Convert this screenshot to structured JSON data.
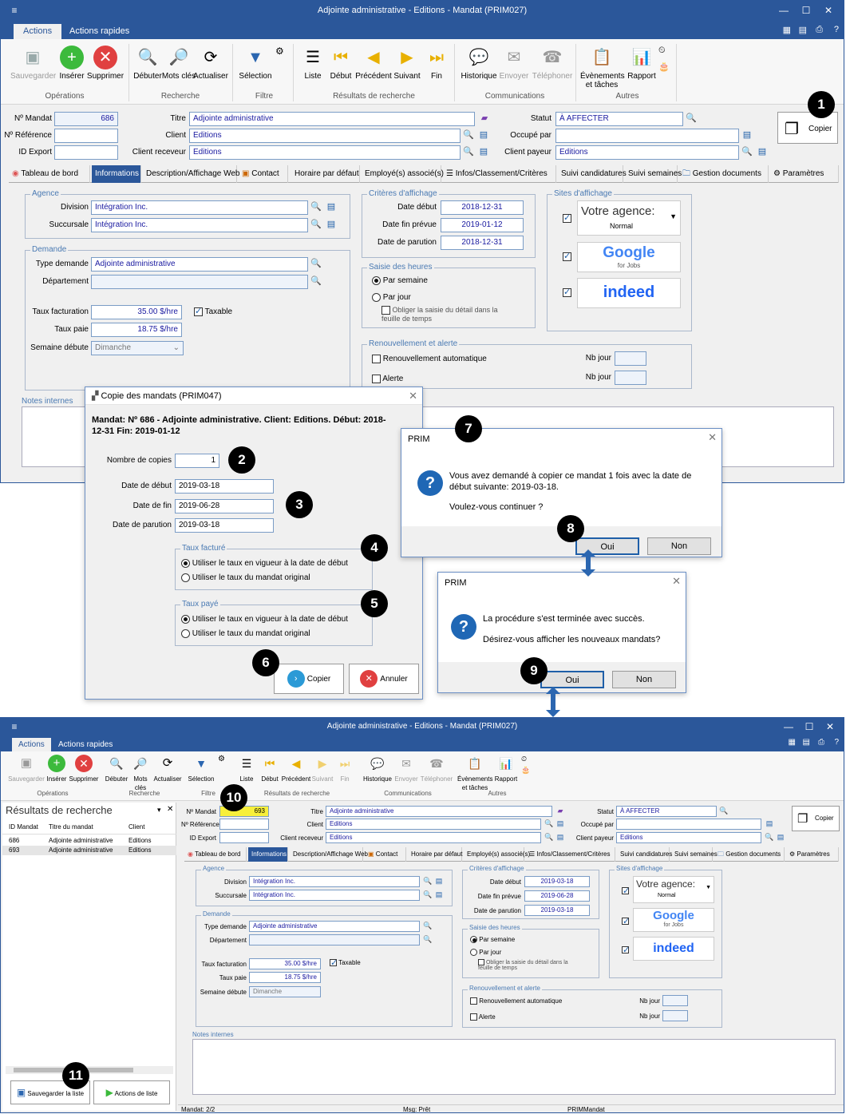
{
  "app_title": "Adjointe administrative - Editions - Mandat (PRIM027)",
  "tabs": [
    "Actions",
    "Actions rapides"
  ],
  "ribbon": {
    "operations": {
      "label": "Opérations",
      "buttons": [
        "Sauvegarder",
        "Insérer",
        "Supprimer"
      ]
    },
    "recherche": {
      "label": "Recherche",
      "buttons": [
        "Débuter",
        "Mots clés",
        "Actualiser"
      ]
    },
    "filtre": {
      "label": "Filtre",
      "buttons": [
        "Sélection"
      ]
    },
    "resultats": {
      "label": "Résultats de recherche",
      "buttons": [
        "Liste",
        "Début",
        "Précédent",
        "Suivant",
        "Fin"
      ]
    },
    "communications": {
      "label": "Communications",
      "buttons": [
        "Historique",
        "Envoyer",
        "Téléphoner"
      ]
    },
    "autres": {
      "label": "Autres",
      "buttons": [
        "Évènements et tâches",
        "Rapport"
      ]
    }
  },
  "header_labels": {
    "no_mandat": "Nº Mandat",
    "no_reference": "Nº Référence",
    "id_export": "ID Export",
    "titre": "Titre",
    "client": "Client",
    "client_receveur": "Client receveur",
    "statut": "Statut",
    "occupe_par": "Occupé par",
    "client_payeur": "Client payeur",
    "copier": "Copier"
  },
  "header_top": {
    "no_mandat": "686",
    "titre": "Adjointe administrative",
    "client": "Editions",
    "client_receveur": "Editions",
    "statut": "À AFFECTER",
    "client_payeur": "Editions"
  },
  "header_bottom": {
    "no_mandat": "693",
    "titre": "Adjointe administrative",
    "client": "Editions",
    "client_receveur": "Editions",
    "statut": "À AFFECTER",
    "client_payeur": "Editions"
  },
  "subtabs": [
    "Tableau de bord",
    "Informations",
    "Description/Affichage Web",
    "Contact",
    "Horaire par défaut",
    "Employé(s) associé(s)",
    "Infos/Classement/Critères",
    "Suivi candidatures",
    "Suivi semaines",
    "Gestion documents",
    "Paramètres"
  ],
  "form_labels": {
    "agence": "Agence",
    "division": "Division",
    "succursale": "Succursale",
    "demande": "Demande",
    "type_demande": "Type demande",
    "departement": "Département",
    "taux_facturation": "Taux facturation",
    "taux_paie": "Taux paie",
    "semaine_debute": "Semaine débute",
    "taxable": "Taxable",
    "criteres": "Critères d'affichage",
    "date_debut": "Date début",
    "date_fin_prevue": "Date fin prévue",
    "date_parution": "Date de parution",
    "saisie": "Saisie des heures",
    "par_semaine": "Par semaine",
    "par_jour": "Par jour",
    "obliger": "Obliger la saisie du détail dans la feuille de temps",
    "renouvellement": "Renouvellement et alerte",
    "renouvellement_auto": "Renouvellement automatique",
    "alerte": "Alerte",
    "nb_jour": "Nb jour",
    "sites": "Sites d'affichage",
    "notes": "Notes internes",
    "votre_agence": "Votre agence:",
    "normal": "Normal",
    "google": "Google",
    "for_jobs": "for Jobs",
    "indeed": "indeed"
  },
  "form_top": {
    "division": "Intégration Inc.",
    "succursale": "Intégration Inc.",
    "type_demande": "Adjointe administrative",
    "taux_facturation": "35.00 $/hre",
    "taux_paie": "18.75 $/hre",
    "semaine_debute": "Dimanche",
    "date_debut": "2018-12-31",
    "date_fin_prevue": "2019-01-12",
    "date_parution": "2018-12-31"
  },
  "form_bottom": {
    "division": "Intégration Inc.",
    "succursale": "Intégration Inc.",
    "type_demande": "Adjointe administrative",
    "taux_facturation": "35.00 $/hre",
    "taux_paie": "18.75 $/hre",
    "semaine_debute": "Dimanche",
    "date_debut": "2019-03-18",
    "date_fin_prevue": "2019-06-28",
    "date_parution": "2019-03-18"
  },
  "copy_dialog": {
    "title": "Copie des mandats (PRIM047)",
    "summary": "Mandat: Nº 686 - Adjointe administrative.  Client: Editions.  Début: 2018-12-31 Fin: 2019-01-12",
    "nombre_copies_label": "Nombre de copies",
    "nombre_copies": "1",
    "date_debut_label": "Date de début",
    "date_debut": "2019-03-18",
    "date_fin_label": "Date de fin",
    "date_fin": "2019-06-28",
    "date_parution_label": "Date de parution",
    "date_parution": "2019-03-18",
    "taux_facture": "Taux facturé",
    "taux_paye": "Taux payé",
    "opt_vigueur": "Utiliser le taux en vigueur à la date de début",
    "opt_original": "Utiliser le taux du mandat original",
    "copier": "Copier",
    "annuler": "Annuler"
  },
  "confirm_dialog": {
    "title": "PRIM",
    "line1": "Vous avez demandé à copier ce mandat 1 fois avec la date de début suivante: 2019-03-18.",
    "line2": "Voulez-vous continuer ?",
    "oui": "Oui",
    "non": "Non"
  },
  "success_dialog": {
    "title": "PRIM",
    "line1": "La procédure s'est terminée avec succès.",
    "line2": "Désirez-vous afficher les nouveaux mandats?",
    "oui": "Oui",
    "non": "Non"
  },
  "results_panel": {
    "title": "Résultats de recherche",
    "columns": [
      "ID Mandat",
      "Titre du mandat",
      "Client"
    ],
    "rows": [
      [
        "686",
        "Adjointe administrative",
        "Editions"
      ],
      [
        "693",
        "Adjointe administrative",
        "Editions"
      ]
    ],
    "save_list": "Sauvegarder la liste",
    "list_actions": "Actions de liste"
  },
  "status_bar": {
    "mandat": "Mandat: 2/2",
    "msg": "Msg: Prêt",
    "module": "PRIMMandat"
  },
  "callouts": [
    "1",
    "2",
    "3",
    "4",
    "5",
    "6",
    "7",
    "8",
    "9",
    "10",
    "11"
  ],
  "colors": {
    "accent": "#2b579a",
    "field_text": "#1a1aa0",
    "highlight": "#f7ef3b"
  }
}
